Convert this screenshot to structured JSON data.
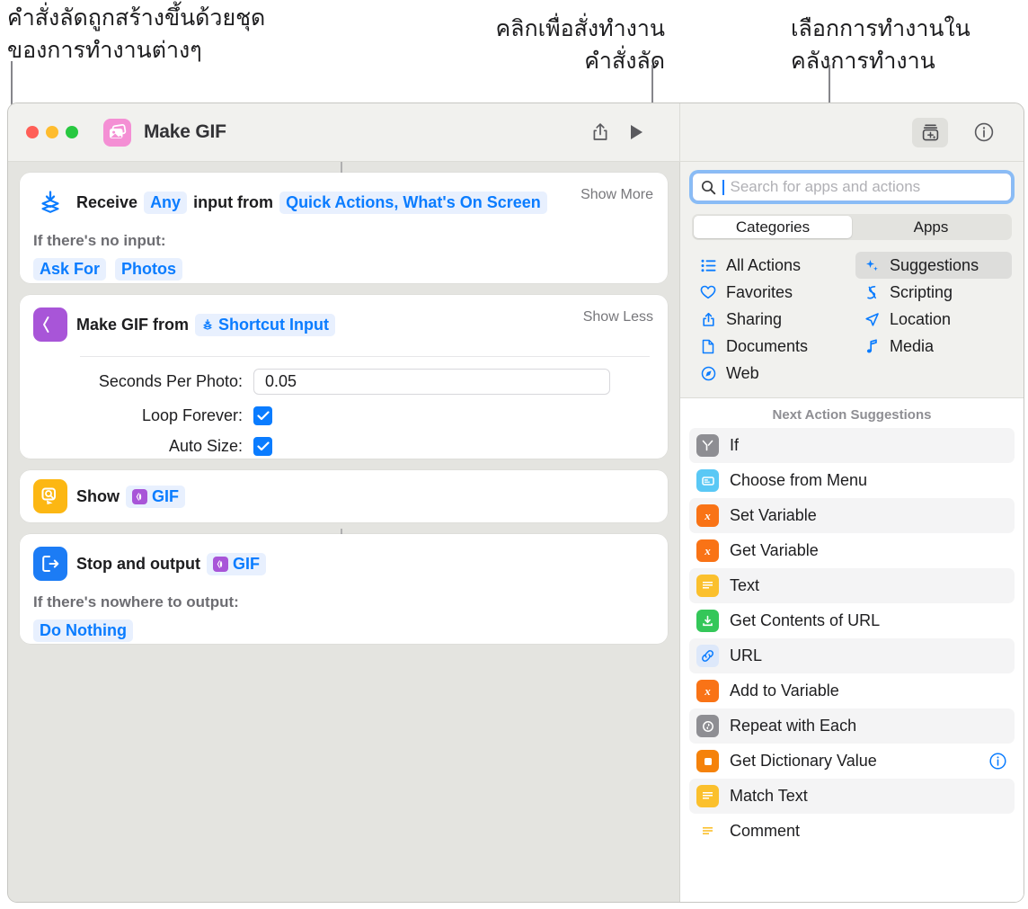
{
  "annotations": {
    "left": "คำสั่งลัดถูกสร้างขึ้นด้วยชุด\nของการทำงานต่างๆ",
    "middle": "คลิกเพื่อสั่งทำงาน\nคำสั่งลัด",
    "right": "เลือกการทำงานใน\nคลังการทำงาน"
  },
  "window": {
    "title": "Make GIF",
    "app_icon": "photos-stack-icon",
    "traffic_lights": [
      "close-button",
      "minimize-button",
      "zoom-button"
    ],
    "toolbar": {
      "share_label": "share-icon",
      "run_label": "play-icon",
      "library_label": "action-library-icon",
      "info_label": "info-icon"
    }
  },
  "editor": {
    "actions": [
      {
        "icon": "receive-input-icon",
        "title_prefix": "Receive",
        "token_any": "Any",
        "title_mid": "input from",
        "token_sources": "Quick Actions, What's On Screen",
        "toggle": "Show More",
        "sub_label": "If there's no input:",
        "tokens": [
          "Ask For",
          "Photos"
        ]
      },
      {
        "icon": "make-gif-icon",
        "title_prefix": "Make GIF from",
        "token_input": "Shortcut Input",
        "toggle": "Show Less",
        "fields": [
          {
            "label": "Seconds Per Photo:",
            "value": "0.05",
            "type": "text"
          },
          {
            "label": "Loop Forever:",
            "value": "checked",
            "type": "checkbox"
          },
          {
            "label": "Auto Size:",
            "value": "checked",
            "type": "checkbox"
          }
        ]
      },
      {
        "icon": "show-result-icon",
        "title_prefix": "Show",
        "token_gif": "GIF"
      },
      {
        "icon": "stop-output-icon",
        "title_prefix": "Stop and output",
        "token_gif": "GIF",
        "sub_label": "If there's nowhere to output:",
        "tokens": [
          "Do Nothing"
        ]
      }
    ]
  },
  "sidebar": {
    "search": {
      "placeholder": "Search for apps and actions",
      "value": ""
    },
    "segments": [
      {
        "label": "Categories",
        "selected": true
      },
      {
        "label": "Apps",
        "selected": false
      }
    ],
    "categories_left": [
      {
        "label": "All Actions",
        "icon": "list-bullet-icon",
        "selected": false
      },
      {
        "label": "Favorites",
        "icon": "heart-icon",
        "selected": false
      },
      {
        "label": "Sharing",
        "icon": "share-up-icon",
        "selected": false
      },
      {
        "label": "Documents",
        "icon": "document-icon",
        "selected": false
      },
      {
        "label": "Web",
        "icon": "safari-compass-icon",
        "selected": false
      }
    ],
    "categories_right": [
      {
        "label": "Suggestions",
        "icon": "sparkles-icon",
        "selected": true
      },
      {
        "label": "Scripting",
        "icon": "scripting-icon",
        "selected": false
      },
      {
        "label": "Location",
        "icon": "location-arrow-icon",
        "selected": false
      },
      {
        "label": "Media",
        "icon": "music-note-icon",
        "selected": false
      }
    ],
    "suggestions_header": "Next Action Suggestions",
    "suggestions": [
      {
        "label": "If",
        "icon": "if-icon",
        "color": "#8e8e93",
        "has_info": false
      },
      {
        "label": "Choose from Menu",
        "icon": "menu-icon",
        "color": "#5ac8f5",
        "has_info": false
      },
      {
        "label": "Set Variable",
        "icon": "variable-icon",
        "color": "#f97316",
        "has_info": false
      },
      {
        "label": "Get Variable",
        "icon": "variable-icon",
        "color": "#f97316",
        "has_info": false
      },
      {
        "label": "Text",
        "icon": "text-icon",
        "color": "#fbc02d",
        "has_info": false
      },
      {
        "label": "Get Contents of URL",
        "icon": "download-icon",
        "color": "#34c759",
        "has_info": false
      },
      {
        "label": "URL",
        "icon": "link-icon",
        "color": "#dde8fa",
        "has_info": false
      },
      {
        "label": "Add to Variable",
        "icon": "variable-icon",
        "color": "#f97316",
        "has_info": false
      },
      {
        "label": "Repeat with Each",
        "icon": "repeat-icon",
        "color": "#8e8e93",
        "has_info": false
      },
      {
        "label": "Get Dictionary Value",
        "icon": "dictionary-icon",
        "color": "#f5820b",
        "has_info": true
      },
      {
        "label": "Match Text",
        "icon": "text-icon",
        "color": "#fbc02d",
        "has_info": false
      },
      {
        "label": "Comment",
        "icon": "comment-icon",
        "color": "#ffffff",
        "has_info": false
      }
    ]
  },
  "colors": {
    "accent_blue": "#0a7cff",
    "canvas": "#e4e4e0",
    "chrome": "#f1f1ee"
  }
}
